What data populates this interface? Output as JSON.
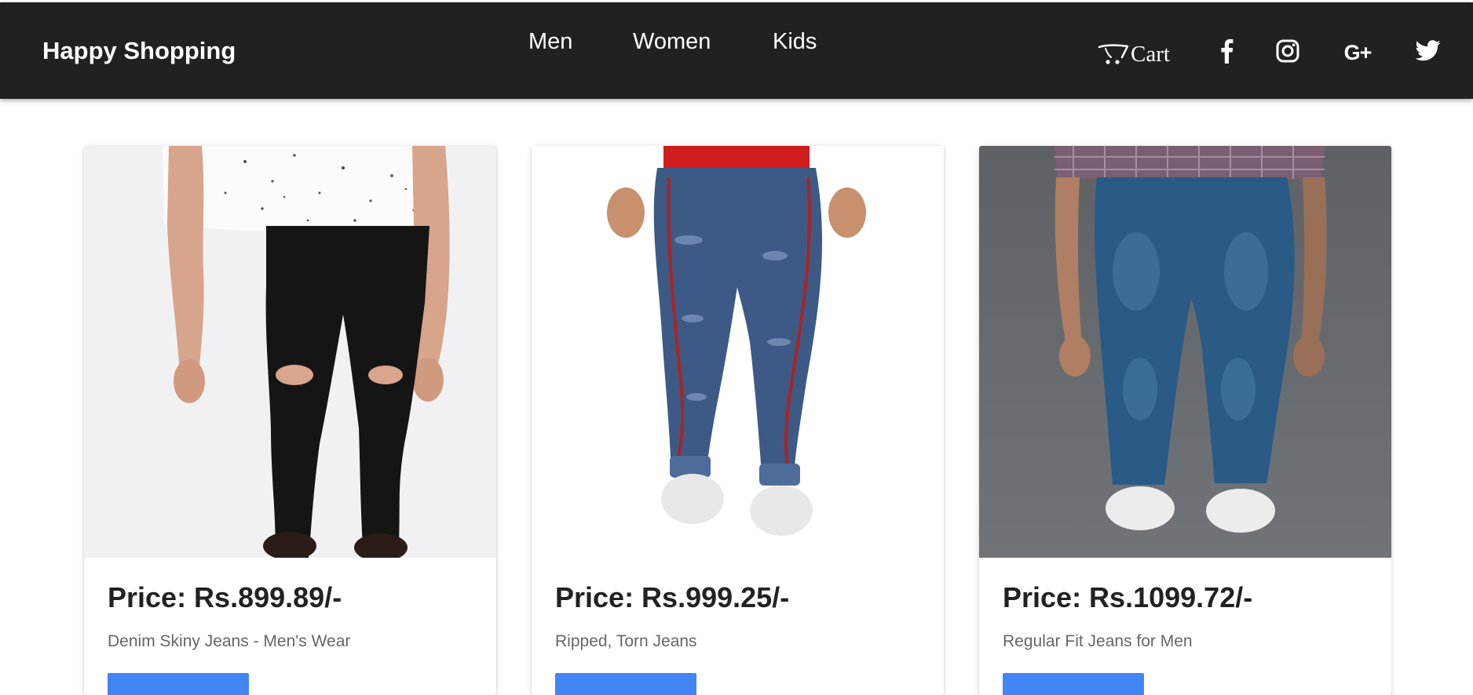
{
  "header": {
    "brand": "Happy Shopping",
    "nav": [
      {
        "label": "Men"
      },
      {
        "label": "Women"
      },
      {
        "label": "Kids"
      }
    ],
    "cart_label": "Cart",
    "social_icons": [
      "facebook-icon",
      "instagram-icon",
      "google-plus-icon",
      "twitter-icon"
    ],
    "google_plus_text": "G+",
    "background_color": "#212121"
  },
  "products": [
    {
      "price": "Price: Rs.899.89/-",
      "description": "Denim Skiny Jeans - Men's Wear",
      "button_label": ""
    },
    {
      "price": "Price: Rs.999.25/-",
      "description": "Ripped, Torn Jeans",
      "button_label": ""
    },
    {
      "price": "Price: Rs.1099.72/-",
      "description": "Regular Fit Jeans for Men",
      "button_label": ""
    }
  ],
  "colors": {
    "accent": "#4285f4",
    "price_text": "#222222",
    "description_text": "#666666"
  }
}
